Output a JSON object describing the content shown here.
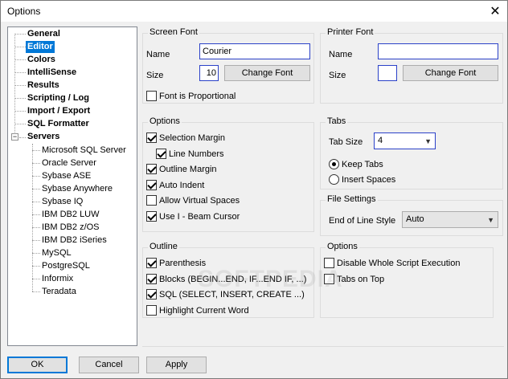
{
  "window": {
    "title": "Options"
  },
  "tree": {
    "top_items": [
      "General",
      "Editor",
      "Colors",
      "IntelliSense",
      "Results",
      "Scripting / Log",
      "Import / Export",
      "SQL Formatter",
      "Servers"
    ],
    "servers": [
      "Microsoft SQL Server",
      "Oracle Server",
      "Sybase ASE",
      "Sybase Anywhere",
      "Sybase IQ",
      "IBM DB2 LUW",
      "IBM DB2 z/OS",
      "IBM DB2 iSeries",
      "MySQL",
      "PostgreSQL",
      "Informix",
      "Teradata"
    ],
    "selected": "Editor",
    "expander_symbol": "−"
  },
  "screen_font": {
    "title": "Screen Font",
    "name_label": "Name",
    "name_value": "Courier",
    "size_label": "Size",
    "size_value": "10",
    "change_button": "Change Font",
    "proportional_label": "Font is Proportional"
  },
  "printer_font": {
    "title": "Printer Font",
    "name_label": "Name",
    "name_value": "",
    "size_label": "Size",
    "size_value": "",
    "change_button": "Change Font"
  },
  "options": {
    "title": "Options",
    "selection_margin": "Selection Margin",
    "line_numbers": "Line Numbers",
    "outline_margin": "Outline Margin",
    "auto_indent": "Auto Indent",
    "allow_virtual_spaces": "Allow Virtual Spaces",
    "use_i_beam": "Use I - Beam Cursor"
  },
  "tabs": {
    "title": "Tabs",
    "tab_size_label": "Tab Size",
    "tab_size_value": "4",
    "keep_tabs": "Keep Tabs",
    "insert_spaces": "Insert Spaces"
  },
  "file_settings": {
    "title": "File Settings",
    "eol_label": "End of Line Style",
    "eol_value": "Auto"
  },
  "outline": {
    "title": "Outline",
    "parenthesis": "Parenthesis",
    "blocks": "Blocks (BEGIN...END, IF...END IF, ...)",
    "sql": "SQL (SELECT, INSERT, CREATE ...)",
    "highlight_word": "Highlight Current Word"
  },
  "options2": {
    "title": "Options",
    "disable_whole_script": "Disable Whole Script Execution",
    "tabs_on_top": "Tabs on Top"
  },
  "buttons": {
    "ok": "OK",
    "cancel": "Cancel",
    "apply": "Apply"
  },
  "watermark": "SOFTPEDIA",
  "icons": {
    "close": "✕",
    "dropdown": "▼"
  }
}
